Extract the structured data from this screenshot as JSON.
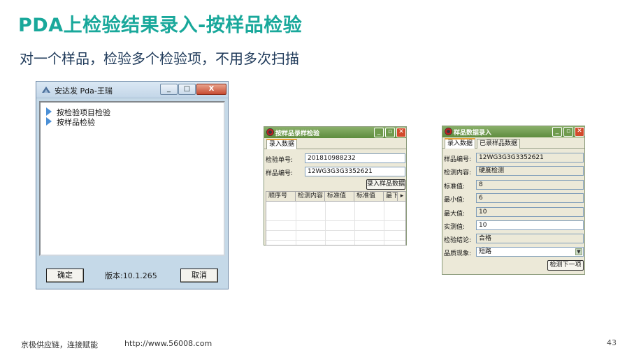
{
  "slide": {
    "title": "PDA上检验结果录入-按样品检验",
    "subtitle": "对一个样品，检验多个检验项，不用多次扫描",
    "footer_left": "京极供应链，连接赋能",
    "footer_url": "http://www.56008.com",
    "page_number": "43"
  },
  "main_window": {
    "title": "安达发 Pda-王瑞",
    "min_label": "_",
    "max_label": "□",
    "close_label": "X",
    "tree_items": [
      {
        "label": "按检验项目检验"
      },
      {
        "label": "按样品检验"
      }
    ],
    "ok_label": "确定",
    "version": "版本:10.1.265",
    "cancel_label": "取消"
  },
  "sample_window": {
    "title": "按样品录样检验",
    "tabs": [
      {
        "label": "录入数据"
      }
    ],
    "fields": [
      {
        "label": "检验单号:",
        "value": "201810988232"
      },
      {
        "label": "样品编号:",
        "value": "12WG3G3G3352621"
      }
    ],
    "load_button": "录入样品数据",
    "grid_columns": [
      "顺序号",
      "检测内容",
      "标准值",
      "标准值",
      "最下"
    ]
  },
  "entry_window": {
    "title": "样品数据录入",
    "tabs": [
      {
        "label": "录入数据"
      },
      {
        "label": "已录样品数据"
      }
    ],
    "fields": [
      {
        "label": "样品编号:",
        "value": "12WG3G3G3352621"
      },
      {
        "label": "检测内容:",
        "value": "硬度检测"
      },
      {
        "label": "标准值:",
        "value": "8"
      },
      {
        "label": "最小值:",
        "value": "6"
      },
      {
        "label": "最大值:",
        "value": "10"
      },
      {
        "label": "实测值:",
        "value": "10"
      },
      {
        "label": "检验结论:",
        "value": "合格"
      },
      {
        "label": "品质现象:",
        "value": "短路"
      }
    ],
    "next_button": "检测下一项"
  },
  "colors": {
    "title": "#19a89b",
    "subtitle": "#1f3a5a",
    "titlebar_green": "#5e8c3e"
  }
}
